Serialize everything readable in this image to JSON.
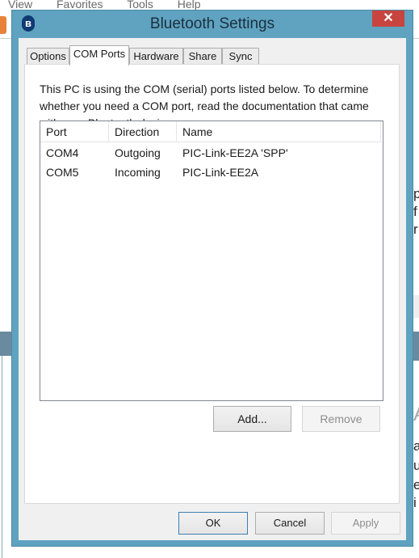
{
  "background": {
    "menu": [
      "View",
      "Favorites",
      "Tools",
      "Help"
    ],
    "right_fragments": [
      "p",
      "f",
      "r",
      "A",
      "a",
      "u",
      "e",
      "i"
    ]
  },
  "window": {
    "title": "Bluetooth Settings",
    "icon": "bluetooth-icon",
    "icon_glyph": "ʙ",
    "close_glyph": "✕",
    "tabs": [
      {
        "label": "Options",
        "active": false
      },
      {
        "label": "COM Ports",
        "active": true
      },
      {
        "label": "Hardware",
        "active": false
      },
      {
        "label": "Share",
        "active": false
      },
      {
        "label": "Sync",
        "active": false
      }
    ],
    "description": "This PC is using the COM (serial) ports listed below. To determine whether you need a COM port, read the documentation that came with your Bluetooth device.",
    "ports": {
      "columns": [
        "Port",
        "Direction",
        "Name"
      ],
      "rows": [
        [
          "COM4",
          "Outgoing",
          "PIC-Link-EE2A 'SPP'"
        ],
        [
          "COM5",
          "Incoming",
          "PIC-Link-EE2A"
        ]
      ]
    },
    "add_label": "Add...",
    "remove_label": "Remove",
    "ok_label": "OK",
    "cancel_label": "Cancel",
    "apply_label": "Apply",
    "accent_color": "#5fa3c0",
    "close_color": "#c7443f"
  }
}
